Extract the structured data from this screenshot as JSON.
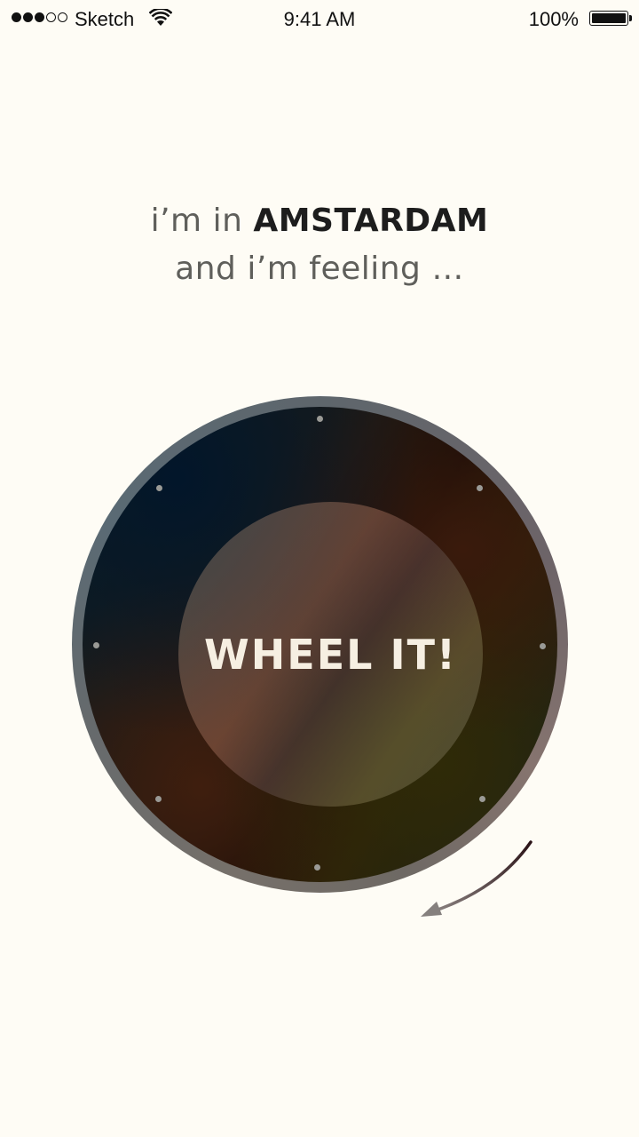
{
  "status_bar": {
    "carrier": "Sketch",
    "time": "9:41 AM",
    "battery_percent": "100%"
  },
  "headline": {
    "line1_prefix": "i’m in",
    "city": "AMSTARDAM",
    "line2": "and i’m feeling …"
  },
  "wheel": {
    "button_label": "WHEEL IT!"
  },
  "icons": {
    "wifi": "wifi-icon",
    "battery": "battery-icon",
    "signal": "signal-strength-icon",
    "spin_arrow": "curved-arrow-icon"
  }
}
